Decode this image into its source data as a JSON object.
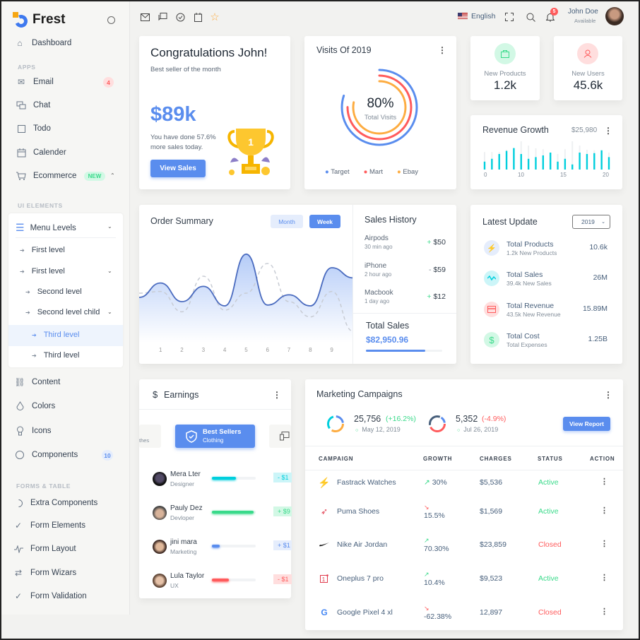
{
  "app": {
    "name": "Frest"
  },
  "sidebar": {
    "dashboard": "Dashboard",
    "sections": {
      "apps": "APPS",
      "ui_elements": "UI ELEMENTS",
      "forms_table": "FORMS & TABLE"
    },
    "apps": [
      {
        "label": "Email",
        "icon": "mail-icon",
        "badge": "4"
      },
      {
        "label": "Chat",
        "icon": "chat-icon"
      },
      {
        "label": "Todo",
        "icon": "checkbox-icon"
      },
      {
        "label": "Calender",
        "icon": "calendar-icon"
      },
      {
        "label": "Ecommerce",
        "icon": "cart-icon",
        "badge": "NEW"
      }
    ],
    "menu_levels": {
      "label": "Menu Levels",
      "items": [
        {
          "label": "First level"
        },
        {
          "label": "First level"
        },
        {
          "label": "Second level"
        },
        {
          "label": "Second level child"
        },
        {
          "label": "Third level",
          "active": true
        },
        {
          "label": "Third level"
        }
      ]
    },
    "ui": [
      {
        "label": "Content",
        "icon": "content-icon"
      },
      {
        "label": "Colors",
        "icon": "droplet-icon"
      },
      {
        "label": "Icons",
        "icon": "bulb-icon"
      },
      {
        "label": "Components",
        "icon": "circle-icon",
        "badge": "10"
      }
    ],
    "forms": [
      {
        "label": "Extra Components",
        "icon": "loader-icon"
      },
      {
        "label": "Form Elements",
        "icon": "check-icon"
      },
      {
        "label": "Form Layout",
        "icon": "pulse-icon"
      },
      {
        "label": "Form Wizars",
        "icon": "swap-icon"
      },
      {
        "label": "Form Validation",
        "icon": "check-icon"
      }
    ]
  },
  "topbar": {
    "language": "English",
    "notifications": "5",
    "user": {
      "name": "John Doe",
      "status": "Available"
    }
  },
  "congrats": {
    "title": "Congratulations John!",
    "subtitle": "Best seller of the month",
    "amount": "$89k",
    "line1": "You have done 57.6%",
    "line2": "more sales today.",
    "button": "View Sales"
  },
  "visits": {
    "title": "Visits Of 2019",
    "percent": "80%",
    "center_label": "Total Visits",
    "legend": [
      {
        "label": "Target",
        "color": "#5a8dee"
      },
      {
        "label": "Mart",
        "color": "#ff5b5c"
      },
      {
        "label": "Ebay",
        "color": "#fdac41"
      }
    ],
    "arcs": [
      {
        "name": "Target",
        "value": 0.8,
        "color": "#5a8dee"
      },
      {
        "name": "Mart",
        "value": 0.75,
        "color": "#ff5b5c"
      },
      {
        "name": "Ebay",
        "value": 0.78,
        "color": "#fdac41"
      }
    ]
  },
  "stats": [
    {
      "label": "New Products",
      "value": "1.2k",
      "icon": "bag-icon",
      "color": "#39da8a",
      "bg": "#d2f8e5"
    },
    {
      "label": "New Users",
      "value": "45.6k",
      "icon": "user-icon",
      "color": "#ff5b5c",
      "bg": "#ffdede"
    }
  ],
  "revenue": {
    "title": "Revenue Growth",
    "amount": "$25,980",
    "ticks": [
      "0",
      "10",
      "15",
      "20"
    ],
    "values": [
      28,
      38,
      55,
      66,
      76,
      55,
      38,
      44,
      50,
      60,
      28,
      38,
      18,
      60,
      55,
      58,
      68,
      44
    ],
    "bg_values": [
      62,
      62,
      62,
      70,
      76,
      100,
      85,
      75,
      72,
      60,
      55,
      72,
      100,
      85,
      70,
      68,
      68,
      60
    ]
  },
  "order_summary": {
    "title": "Order Summary",
    "tabs": [
      {
        "label": "Month",
        "active": false
      },
      {
        "label": "Week",
        "active": true
      }
    ],
    "x_labels": [
      "1",
      "2",
      "3",
      "4",
      "5",
      "6",
      "7",
      "8",
      "9"
    ],
    "series_main": [
      45,
      62,
      40,
      58,
      35,
      96,
      36,
      48,
      35,
      80,
      68
    ],
    "series_dashed": [
      50,
      52,
      28,
      70,
      30,
      50,
      85,
      40,
      22,
      52,
      5
    ]
  },
  "sales_history": {
    "title": "Sales History",
    "items": [
      {
        "name": "Airpods",
        "time": "30 min ago",
        "sign": "+",
        "amount": "$50"
      },
      {
        "name": "iPhone",
        "time": "2 hour ago",
        "sign": "-",
        "amount": "$59"
      },
      {
        "name": "Macbook",
        "time": "1 day ago",
        "sign": "+",
        "amount": "$12"
      }
    ],
    "total_label": "Total Sales",
    "total_value": "$82,950.96",
    "progress": 0.78
  },
  "latest_update": {
    "title": "Latest Update",
    "year": "2019",
    "items": [
      {
        "title": "Total Products",
        "sub": "1.2k New Products",
        "value": "10.6k",
        "icon": "bolt-icon",
        "color": "#5a8dee",
        "bg": "#e5edfc"
      },
      {
        "title": "Total Sales",
        "sub": "39.4k New Sales",
        "value": "26M",
        "icon": "activity-icon",
        "color": "#00cfdd",
        "bg": "#ccf5f8"
      },
      {
        "title": "Total Revenue",
        "sub": "43.5k New Revenue",
        "value": "15.89M",
        "icon": "credit-card-icon",
        "color": "#ff5b5c",
        "bg": "#ffdede"
      },
      {
        "title": "Total Cost",
        "sub": "Total Expenses",
        "value": "1.25B",
        "icon": "dollar-icon",
        "color": "#39da8a",
        "bg": "#d2f8e5"
      }
    ]
  },
  "earnings": {
    "title": "Earnings",
    "left_tab_sub": "thes",
    "active_tab": {
      "title": "Best Sellers",
      "sub": "Clothing"
    },
    "people": [
      {
        "name": "Mera Lter",
        "role": "Designer",
        "progress": 0.55,
        "color": "#00cfdd",
        "amount": "- $1",
        "amt_bg": "#ccf5f8",
        "amt_color": "#00cfdd"
      },
      {
        "name": "Pauly Dez",
        "role": "Devloper",
        "progress": 0.95,
        "color": "#39da8a",
        "amount": "+ $9",
        "amt_bg": "#d2f8e5",
        "amt_color": "#39da8a"
      },
      {
        "name": "jini mara",
        "role": "Marketing",
        "progress": 0.18,
        "color": "#5a8dee",
        "amount": "+ $1",
        "amt_bg": "#e5edfc",
        "amt_color": "#5a8dee"
      },
      {
        "name": "Lula Taylor",
        "role": "UX",
        "progress": 0.38,
        "color": "#ff5b5c",
        "amount": "- $1",
        "amt_bg": "#ffdede",
        "amt_color": "#ff5b5c"
      }
    ]
  },
  "marketing": {
    "title": "Marketing Campaigns",
    "summary": [
      {
        "value": "25,756",
        "change": "(+16.2%)",
        "trend": "up",
        "date": "May 12, 2019"
      },
      {
        "value": "5,352",
        "change": "(-4.9%)",
        "trend": "down",
        "date": "Jul 26, 2019"
      }
    ],
    "button": "View Report",
    "columns": [
      "CAMPAIGN",
      "GROWTH",
      "CHARGES",
      "STATUS",
      "ACTION"
    ],
    "rows": [
      {
        "brand": "fastrack-logo-icon",
        "name": "Fastrack Watches",
        "growth": "30%",
        "trend": "up",
        "charges": "$5,536",
        "status": "Active"
      },
      {
        "brand": "puma-logo-icon",
        "name": "Puma Shoes",
        "growth": "15.5%",
        "trend": "down",
        "charges": "$1,569",
        "status": "Active"
      },
      {
        "brand": "nike-logo-icon",
        "name": "Nike Air Jordan",
        "growth": "70.30%",
        "trend": "up",
        "charges": "$23,859",
        "status": "Closed"
      },
      {
        "brand": "oneplus-logo-icon",
        "name": "Oneplus 7 pro",
        "growth": "10.4%",
        "trend": "up",
        "charges": "$9,523",
        "status": "Active"
      },
      {
        "brand": "google-logo-icon",
        "name": "Google Pixel 4 xl",
        "growth": "-62.38%",
        "trend": "down",
        "charges": "12,897",
        "status": "Closed"
      }
    ]
  }
}
